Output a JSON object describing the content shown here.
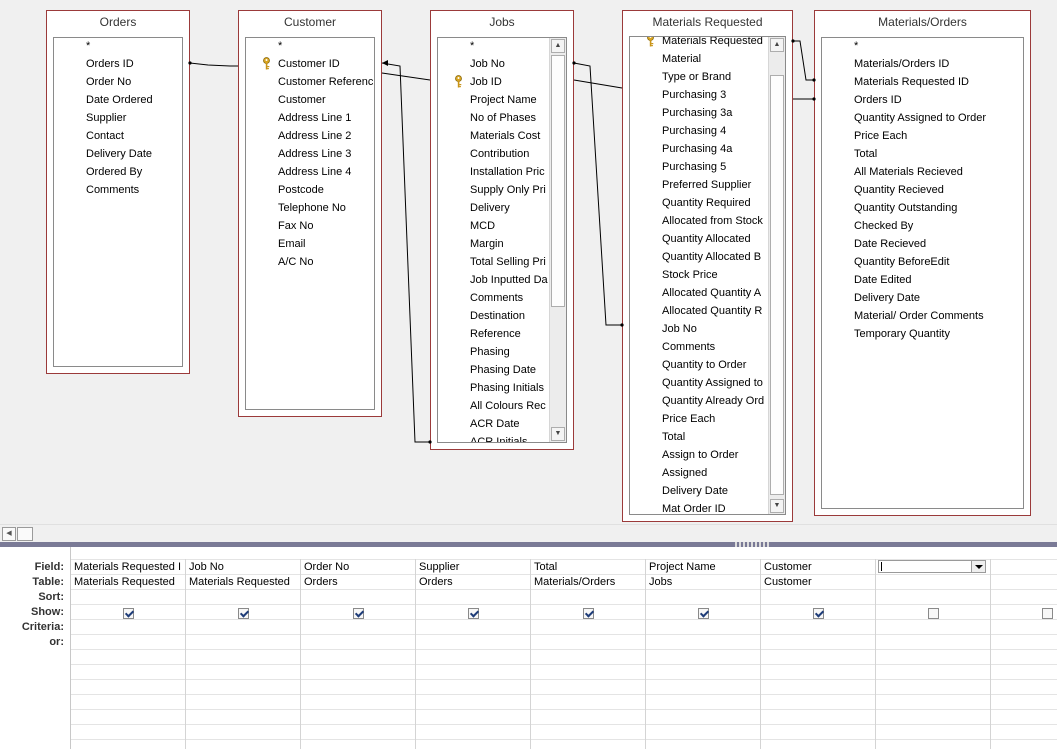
{
  "tables": {
    "orders": {
      "title": "Orders",
      "fields": [
        "*",
        "Orders ID",
        "Order No",
        "Date Ordered",
        "Supplier",
        "Contact",
        "Delivery Date",
        "Ordered By",
        "Comments"
      ]
    },
    "customer": {
      "title": "Customer",
      "fields": [
        "*",
        "Customer ID",
        "Customer Referenc",
        "Customer",
        "Address Line 1",
        "Address Line 2",
        "Address Line 3",
        "Address Line 4",
        "Postcode",
        "Telephone No",
        "Fax No",
        "Email",
        "A/C No"
      ]
    },
    "jobs": {
      "title": "Jobs",
      "fields": [
        "*",
        "Job No",
        "Job ID",
        "Project Name",
        "No of Phases",
        "Materials Cost",
        "Contribution",
        "Installation Pric",
        "Supply Only Pri",
        "Delivery",
        "MCD",
        "Margin",
        "Total Selling Pri",
        "Job Inputted Da",
        "Comments",
        "Destination",
        "Reference",
        "Phasing",
        "Phasing Date",
        "Phasing Initials",
        "All Colours Rec",
        "ACR Date",
        "ACR Initials"
      ]
    },
    "materials_requested": {
      "title": "Materials Requested",
      "fields": [
        "Materials Requested",
        "Material",
        "Type or Brand",
        "Purchasing 3",
        "Purchasing 3a",
        "Purchasing 4",
        "Purchasing 4a",
        "Purchasing 5",
        "Preferred Supplier",
        "Quantity Required",
        "Allocated from Stock",
        "Quantity Allocated",
        "Quantity Allocated B",
        "Stock Price",
        "Allocated Quantity A",
        "Allocated Quantity R",
        "Job No",
        "Comments",
        "Quantity to Order",
        "Quantity Assigned to",
        "Quantity Already Ord",
        "Price Each",
        "Total",
        "Assign to Order",
        "Assigned",
        "Delivery Date",
        "Mat Order ID"
      ]
    },
    "materials_orders": {
      "title": "Materials/Orders",
      "fields": [
        "*",
        "Materials/Orders ID",
        "Materials Requested ID",
        "Orders ID",
        "Quantity Assigned to Order",
        "Price Each",
        "Total",
        "All Materials Recieved",
        "Quantity Recieved",
        "Quantity Outstanding",
        "Checked By",
        "Date Recieved",
        "Quantity BeforeEdit",
        "Date Edited",
        "Delivery Date",
        "Material/ Order Comments",
        "Temporary Quantity"
      ]
    }
  },
  "grid": {
    "row_labels": [
      "Field:",
      "Table:",
      "Sort:",
      "Show:",
      "Criteria:",
      "or:"
    ],
    "columns": [
      {
        "field": "Materials Requested I",
        "table": "Materials Requested",
        "show": true
      },
      {
        "field": "Job No",
        "table": "Materials Requested",
        "show": true
      },
      {
        "field": "Order No",
        "table": "Orders",
        "show": true
      },
      {
        "field": "Supplier",
        "table": "Orders",
        "show": true
      },
      {
        "field": "Total",
        "table": "Materials/Orders",
        "show": true
      },
      {
        "field": "Project Name",
        "table": "Jobs",
        "show": true
      },
      {
        "field": "Customer",
        "table": "Customer",
        "show": true
      },
      {
        "field": "",
        "table": "",
        "show": false
      },
      {
        "field": "",
        "table": "",
        "show": false
      }
    ]
  },
  "icons": {
    "primary_key": "key-icon",
    "scroll_up": "arrow-up-icon",
    "scroll_down": "arrow-down-icon",
    "scroll_left": "arrow-left-icon"
  },
  "colors": {
    "table_border": "#9b3a3a",
    "surface": "#f0f0f0",
    "splitter": "#7a7a96"
  }
}
